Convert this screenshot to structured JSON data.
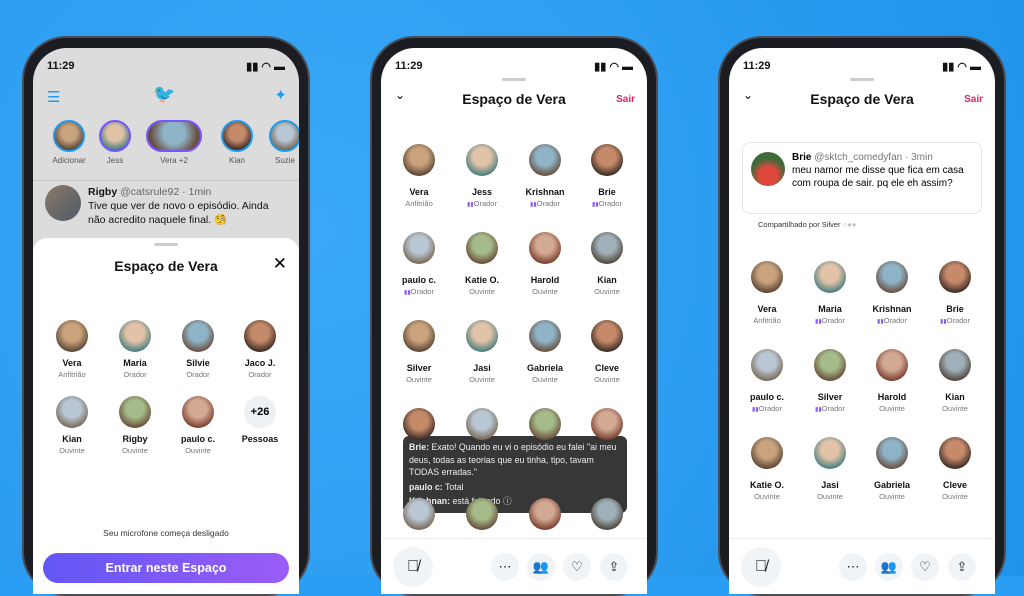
{
  "time": "11:29",
  "left": {
    "stories": [
      {
        "name": "Adicionar"
      },
      {
        "name": "Jess"
      },
      {
        "name": "Vera +2"
      },
      {
        "name": "Kian"
      },
      {
        "name": "Suzie"
      }
    ],
    "tweet": {
      "name": "Rigby",
      "handle": "@catsrule92 · 1min",
      "text": "Tive que ver de novo o episódio. Ainda não acredito naquele final. 🧐"
    },
    "sheet_title": "Espaço de Vera",
    "people": [
      {
        "name": "Vera",
        "role": "Anfitrião"
      },
      {
        "name": "Maria",
        "role": "Orador"
      },
      {
        "name": "Silvie",
        "role": "Orador"
      },
      {
        "name": "Jaco J.",
        "role": "Orador"
      },
      {
        "name": "Kian",
        "role": "Ouvinte"
      },
      {
        "name": "Rigby",
        "role": "Ouvinte"
      },
      {
        "name": "paulo c.",
        "role": "Ouvinte"
      }
    ],
    "more_count": "+26",
    "more_label": "Pessoas",
    "mic_note": "Seu microfone começa desligado",
    "join_button": "Entrar neste Espaço"
  },
  "middle": {
    "title": "Espaço de Vera",
    "leave": "Sair",
    "people": [
      {
        "name": "Vera",
        "role": "Anfitrião"
      },
      {
        "name": "Jess",
        "role": "Orador"
      },
      {
        "name": "Krishnan",
        "role": "Orador"
      },
      {
        "name": "Brie",
        "role": "Orador"
      },
      {
        "name": "paulo c.",
        "role": "Orador"
      },
      {
        "name": "Katie O.",
        "role": "Ouvinte"
      },
      {
        "name": "Harold",
        "role": "Ouvinte"
      },
      {
        "name": "Kian",
        "role": "Ouvinte"
      },
      {
        "name": "Silver",
        "role": "Ouvinte"
      },
      {
        "name": "Jasi",
        "role": "Ouvinte"
      },
      {
        "name": "Gabriela",
        "role": "Ouvinte"
      },
      {
        "name": "Cleve",
        "role": "Ouvinte"
      }
    ],
    "captions": [
      {
        "speaker": "Brie:",
        "text": " Exato! Quando eu vi o episódio eu falei \"ai meu deus, todas as teorias que eu tinha, tipo, tavam TODAS erradas.\""
      },
      {
        "speaker": "paulo c:",
        "text": " Total"
      },
      {
        "speaker": "Krishnan:",
        "text": " está falando ⓘ"
      }
    ]
  },
  "right": {
    "title": "Espaço de Vera",
    "leave": "Sair",
    "shared_tweet": {
      "name": "Brie",
      "handle": "@sktch_comedyfan · 3min",
      "text": "meu namor me disse que fica em casa com roupa de sair. pq ele eh assim?"
    },
    "shared_by": "Compartilhado por Silver",
    "people": [
      {
        "name": "Vera",
        "role": "Anfitrião"
      },
      {
        "name": "Maria",
        "role": "Orador"
      },
      {
        "name": "Krishnan",
        "role": "Orador"
      },
      {
        "name": "Brie",
        "role": "Orador"
      },
      {
        "name": "paulo c.",
        "role": "Orador"
      },
      {
        "name": "Silver",
        "role": "Orador"
      },
      {
        "name": "Harold",
        "role": "Ouvinte"
      },
      {
        "name": "Kian",
        "role": "Ouvinte"
      },
      {
        "name": "Katie O.",
        "role": "Ouvinte"
      },
      {
        "name": "Jasi",
        "role": "Ouvinte"
      },
      {
        "name": "Gabriela",
        "role": "Ouvinte"
      },
      {
        "name": "Cleve",
        "role": "Ouvinte"
      }
    ]
  },
  "colors": {
    "twitter_blue": "#1d9bf0",
    "spaces_purple": "#7856ff",
    "leave_red": "#e0245e"
  },
  "icons": [
    "menu-icon",
    "twitter-bird-icon",
    "sparkle-icon",
    "close-icon",
    "chevron-down-icon",
    "mic-off-icon",
    "more-icon",
    "people-icon",
    "heart-add-icon",
    "share-icon"
  ]
}
